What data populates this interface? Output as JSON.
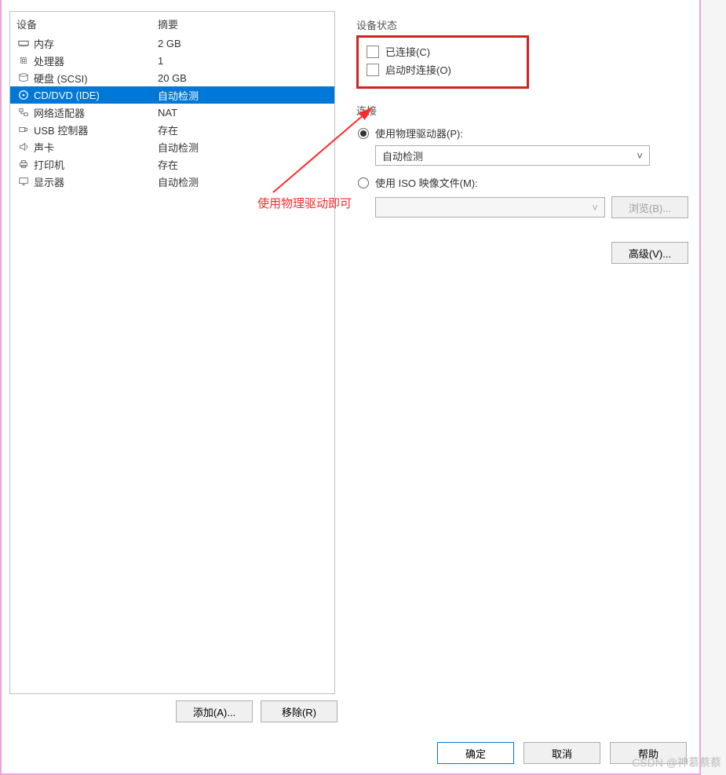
{
  "list": {
    "header_device": "设备",
    "header_summary": "摘要",
    "rows": [
      {
        "icon": "memory-icon",
        "name": "内存",
        "summary": "2 GB",
        "selected": false
      },
      {
        "icon": "cpu-icon",
        "name": "处理器",
        "summary": "1",
        "selected": false
      },
      {
        "icon": "disk-icon",
        "name": "硬盘 (SCSI)",
        "summary": "20 GB",
        "selected": false
      },
      {
        "icon": "cd-icon",
        "name": "CD/DVD (IDE)",
        "summary": "自动检测",
        "selected": true
      },
      {
        "icon": "network-icon",
        "name": "网络适配器",
        "summary": "NAT",
        "selected": false
      },
      {
        "icon": "usb-icon",
        "name": "USB 控制器",
        "summary": "存在",
        "selected": false
      },
      {
        "icon": "sound-icon",
        "name": "声卡",
        "summary": "自动检测",
        "selected": false
      },
      {
        "icon": "printer-icon",
        "name": "打印机",
        "summary": "存在",
        "selected": false
      },
      {
        "icon": "display-icon",
        "name": "显示器",
        "summary": "自动检测",
        "selected": false
      }
    ]
  },
  "buttons": {
    "add": "添加(A)...",
    "remove": "移除(R)",
    "ok": "确定",
    "cancel": "取消",
    "help": "帮助",
    "browse": "浏览(B)...",
    "advanced": "高级(V)..."
  },
  "status": {
    "title": "设备状态",
    "connected": "已连接(C)",
    "connect_at_poweron": "启动时连接(O)"
  },
  "connection": {
    "title": "连接",
    "use_physical": "使用物理驱动器(P):",
    "physical_value": "自动检测",
    "use_iso": "使用 ISO 映像文件(M):"
  },
  "annotation": "使用物理驱动即可",
  "watermark": "CSDN @神慕蔡蔡"
}
